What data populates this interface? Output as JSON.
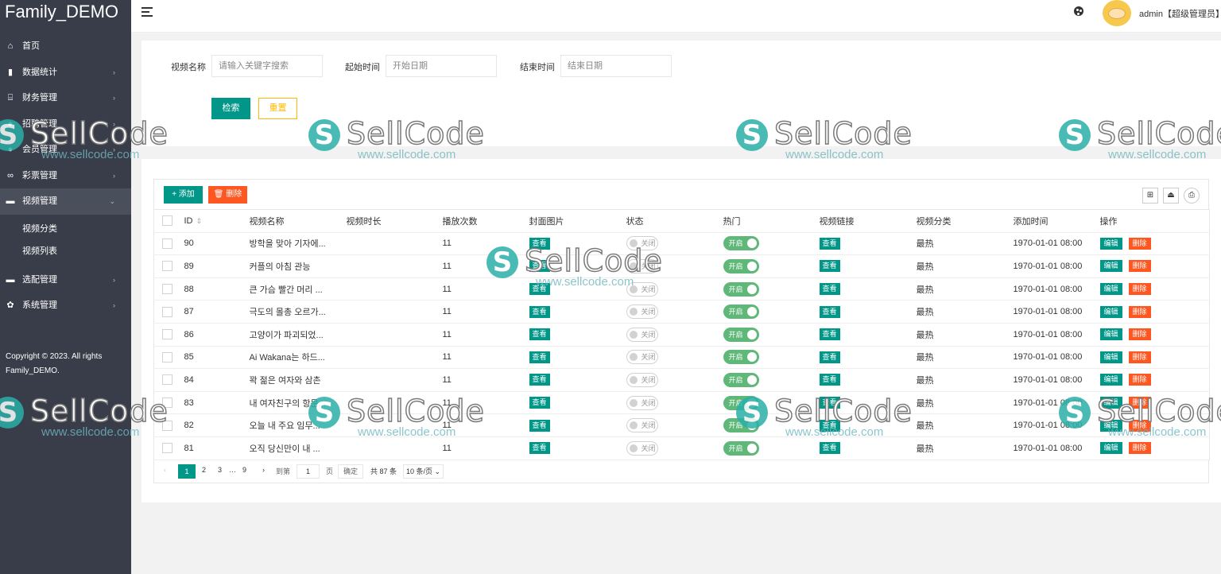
{
  "app": {
    "logo": "Family_DEMO"
  },
  "sidebar": {
    "items": [
      {
        "icon": "home-icon",
        "glyph": "⌂",
        "label": "首页",
        "arrow": ""
      },
      {
        "icon": "bar-chart-icon",
        "glyph": "▮",
        "label": "数据统计",
        "arrow": "›"
      },
      {
        "icon": "bank-icon",
        "glyph": "⌸",
        "label": "财务管理",
        "arrow": "›"
      },
      {
        "icon": "user-icon",
        "glyph": "●",
        "label": "招聘管理",
        "arrow": "›"
      },
      {
        "icon": "users-icon",
        "glyph": "●",
        "label": "会员管理",
        "arrow": "›"
      },
      {
        "icon": "ticket-icon",
        "glyph": "∞",
        "label": "彩票管理",
        "arrow": "›"
      },
      {
        "icon": "video-icon",
        "glyph": "▬",
        "label": "视频管理",
        "arrow": "⌄"
      }
    ],
    "sub_items": [
      {
        "label": "视频分类"
      },
      {
        "label": "视频列表"
      }
    ],
    "items_after": [
      {
        "icon": "option-icon",
        "glyph": "▬",
        "label": "选配管理",
        "arrow": "›"
      },
      {
        "icon": "gear-icon",
        "glyph": "✿",
        "label": "系统管理",
        "arrow": "›"
      }
    ],
    "copyright": "Copyright © 2023. All rights Family_DEMO."
  },
  "header": {
    "user": "admin【超级管理员】",
    "user_arrow": "⌄"
  },
  "search": {
    "name_label": "视频名称",
    "name_placeholder": "请输入关键字搜索",
    "start_label": "起始时间",
    "start_placeholder": "开始日期",
    "end_label": "结束时间",
    "end_placeholder": "结束日期",
    "search_button": "检索",
    "reset_button": "重置"
  },
  "toolbar": {
    "add_label": "+ 添加",
    "delete_label": "🗑 删除"
  },
  "table": {
    "headers": [
      "ID",
      "视频名称",
      "视频时长",
      "播放次数",
      "封面图片",
      "状态",
      "热门",
      "视频链接",
      "视频分类",
      "添加时间",
      "操作"
    ],
    "view_label": "查看",
    "off_label": "关闭",
    "on_label": "开启",
    "edit_label": "编辑",
    "remove_label": "删除",
    "rows": [
      {
        "id": "90",
        "name": "방학을 맞아 기자에...",
        "duration": "",
        "plays": "11",
        "category": "最热",
        "added": "1970-01-01 08:00"
      },
      {
        "id": "89",
        "name": "커플의 아침 관능",
        "duration": "",
        "plays": "11",
        "category": "最热",
        "added": "1970-01-01 08:00"
      },
      {
        "id": "88",
        "name": "큰 가슴 빨간 머리 ...",
        "duration": "",
        "plays": "11",
        "category": "最热",
        "added": "1970-01-01 08:00"
      },
      {
        "id": "87",
        "name": "극도의 몰총 오르가...",
        "duration": "",
        "plays": "11",
        "category": "最热",
        "added": "1970-01-01 08:00"
      },
      {
        "id": "86",
        "name": "고양이가 파괴되었...",
        "duration": "",
        "plays": "11",
        "category": "最热",
        "added": "1970-01-01 08:00"
      },
      {
        "id": "85",
        "name": "Ai Wakana는 하드...",
        "duration": "",
        "plays": "11",
        "category": "最热",
        "added": "1970-01-01 08:00"
      },
      {
        "id": "84",
        "name": "꽉 젊은 여자와 삼촌",
        "duration": "",
        "plays": "11",
        "category": "最热",
        "added": "1970-01-01 08:00"
      },
      {
        "id": "83",
        "name": "내 여자친구의 항문...",
        "duration": "",
        "plays": "11",
        "category": "最热",
        "added": "1970-01-01 08:00"
      },
      {
        "id": "82",
        "name": "오늘 내 주요 임무...",
        "duration": "",
        "plays": "11",
        "category": "最热",
        "added": "1970-01-01 08:00"
      },
      {
        "id": "81",
        "name": "오직 당신만이 내 ...",
        "duration": "",
        "plays": "11",
        "category": "最热",
        "added": "1970-01-01 08:00"
      }
    ]
  },
  "pager": {
    "prev": "‹",
    "pages": [
      "1",
      "2",
      "3",
      "…",
      "9"
    ],
    "next": "›",
    "goto_label": "到第",
    "goto_value": "1",
    "page_unit": "页",
    "confirm": "确定",
    "total": "共 87 条",
    "page_size": "10 条/页 ⌄"
  },
  "watermark": {
    "brand": "SellCode",
    "url": "www.sellcode.com"
  }
}
